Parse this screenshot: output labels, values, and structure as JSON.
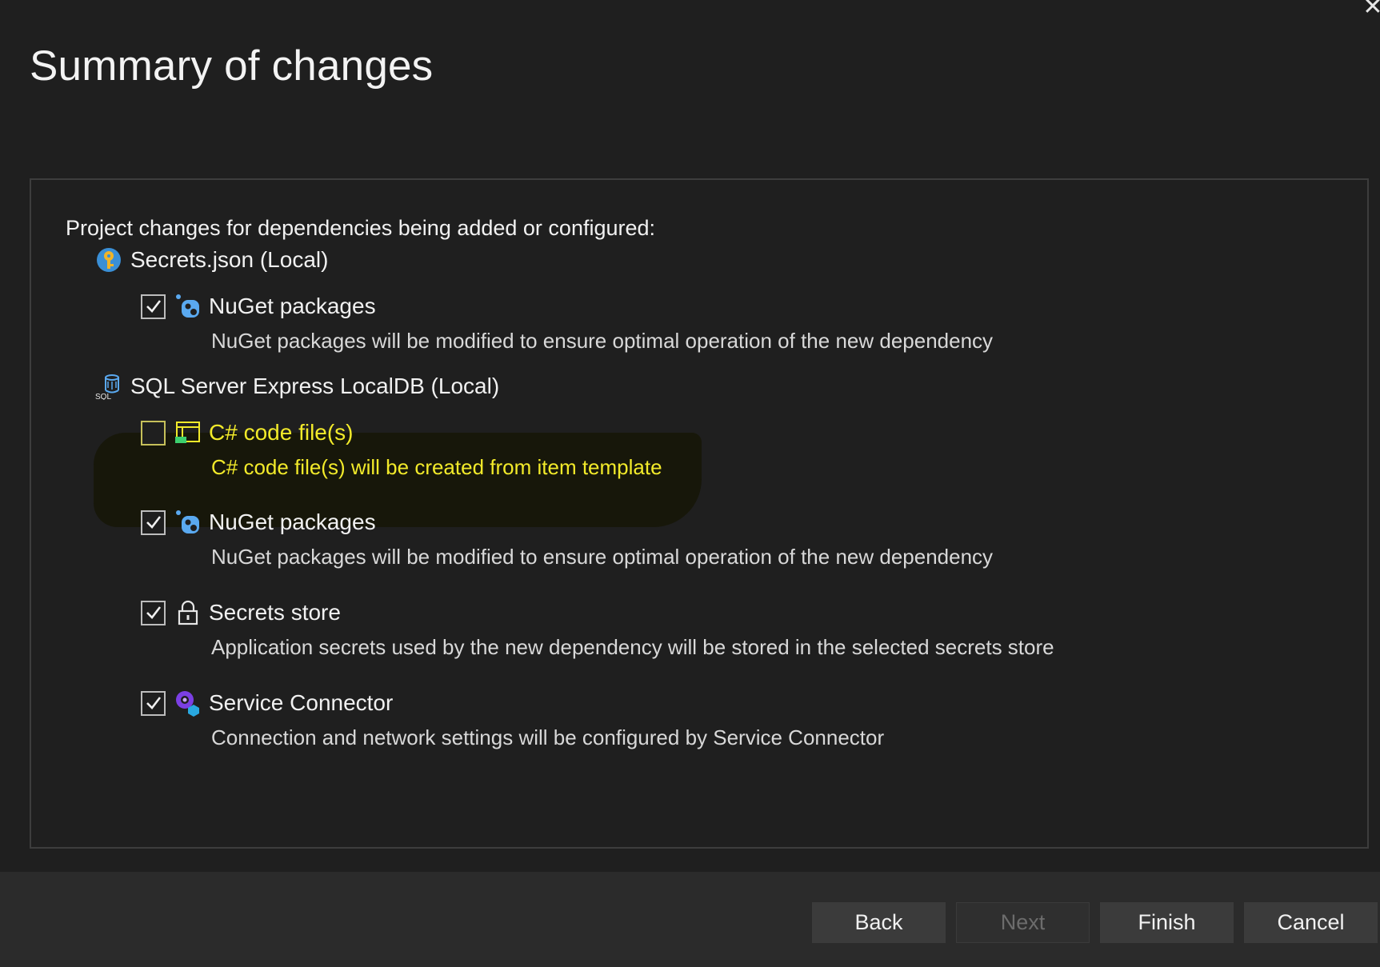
{
  "dialog": {
    "title": "Summary of changes",
    "close_glyph": "✕"
  },
  "panel": {
    "intro": "Project changes for dependencies being added or configured:",
    "groups": [
      {
        "label": "Secrets.json (Local)",
        "icon": "key-icon",
        "items": [
          {
            "label": "NuGet packages",
            "description": "NuGet packages will be modified to ensure optimal operation of the new dependency",
            "checked": true,
            "icon": "nuget-icon"
          }
        ]
      },
      {
        "label": "SQL Server Express LocalDB (Local)",
        "icon": "sql-database-icon",
        "items": [
          {
            "label": "C# code file(s)",
            "description": "C# code file(s) will be created from item template",
            "checked": false,
            "icon": "code-file-icon",
            "highlighted": true
          },
          {
            "label": "NuGet packages",
            "description": "NuGet packages will be modified to ensure optimal operation of the new dependency",
            "checked": true,
            "icon": "nuget-icon"
          },
          {
            "label": "Secrets store",
            "description": "Application secrets used by the new dependency will be stored in the selected secrets store",
            "checked": true,
            "icon": "lock-icon"
          },
          {
            "label": "Service Connector",
            "description": "Connection and network settings will be configured by Service Connector",
            "checked": true,
            "icon": "service-connector-icon"
          }
        ]
      }
    ]
  },
  "footer": {
    "back_label": "Back",
    "next_label": "Next",
    "finish_label": "Finish",
    "cancel_label": "Cancel"
  },
  "colors": {
    "background": "#1f1f1f",
    "footer_background": "#2b2b2b",
    "button_background": "#3b3b3b",
    "highlight_text": "#f2ea2a"
  }
}
